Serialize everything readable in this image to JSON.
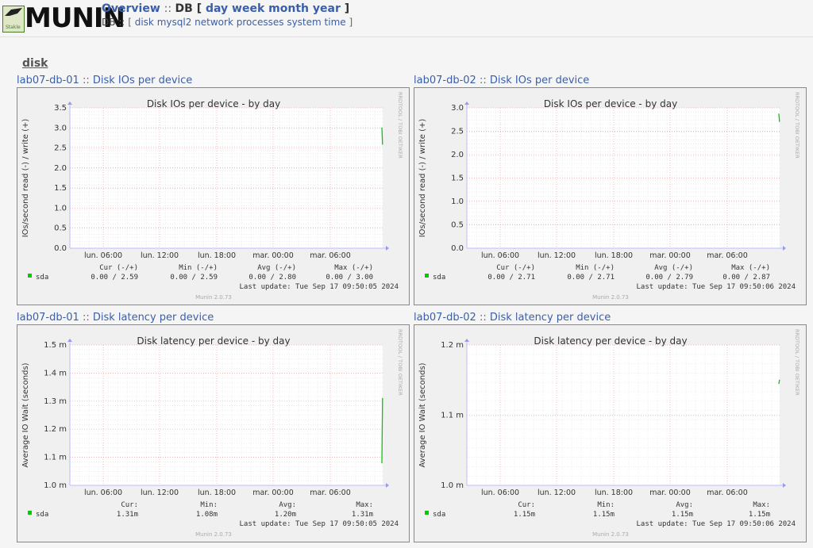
{
  "header": {
    "logo_text": "MUNIN",
    "logo_small": "Stakle",
    "nav_overview": "Overview",
    "nav_group": "DB",
    "periods": [
      "day",
      "week",
      "month",
      "year"
    ],
    "group_label": "DB",
    "categories": [
      "disk",
      "mysql2",
      "network",
      "processes",
      "system",
      "time"
    ]
  },
  "section_title": "disk",
  "graphs": [
    {
      "host": "lab07-db-01",
      "link": "Disk IOs per device",
      "chart_title": "Disk IOs per device - by day",
      "ylabel": "IOs/second read (-) / write (+)",
      "side": "RRDTOOL / TOBI OETIKER",
      "yticks": [
        "3.5",
        "3.0",
        "2.5",
        "2.0",
        "1.5",
        "1.0",
        "0.5",
        "0.0"
      ],
      "xticks": [
        "lun. 06:00",
        "lun. 12:00",
        "lun. 18:00",
        "mar. 00:00",
        "mar. 06:00"
      ],
      "legend_header": [
        "Cur (-/+)",
        "Min (-/+)",
        "Avg (-/+)",
        "Max (-/+)"
      ],
      "series_name": "sda",
      "legend_values": [
        "0.00 /  2.59",
        "0.00 /  2.59",
        "0.00 /  2.80",
        "0.00 /  3.00"
      ],
      "last_update": "Last update: Tue Sep 17 09:50:05 2024",
      "footer": "Munin 2.0.73"
    },
    {
      "host": "lab07-db-02",
      "link": "Disk IOs per device",
      "chart_title": "Disk IOs per device - by day",
      "ylabel": "IOs/second read (-) / write (+)",
      "side": "RRDTOOL / TOBI OETIKER",
      "yticks": [
        "3.0",
        "2.5",
        "2.0",
        "1.5",
        "1.0",
        "0.5",
        "0.0"
      ],
      "xticks": [
        "lun. 06:00",
        "lun. 12:00",
        "lun. 18:00",
        "mar. 00:00",
        "mar. 06:00"
      ],
      "legend_header": [
        "Cur (-/+)",
        "Min (-/+)",
        "Avg (-/+)",
        "Max (-/+)"
      ],
      "series_name": "sda",
      "legend_values": [
        "0.00 /  2.71",
        "0.00 /  2.71",
        "0.00 /  2.79",
        "0.00 /  2.87"
      ],
      "last_update": "Last update: Tue Sep 17 09:50:06 2024",
      "footer": "Munin 2.0.73"
    },
    {
      "host": "lab07-db-01",
      "link": "Disk latency per device",
      "chart_title": "Disk latency per device - by day",
      "ylabel": "Average IO Wait (seconds)",
      "side": "RRDTOOL / TOBI OETIKER",
      "yticks": [
        "1.5 m",
        "1.4 m",
        "1.3 m",
        "1.2 m",
        "1.1 m",
        "1.0 m"
      ],
      "xticks": [
        "lun. 06:00",
        "lun. 12:00",
        "lun. 18:00",
        "mar. 00:00",
        "mar. 06:00"
      ],
      "legend_header": [
        "Cur:",
        "Min:",
        "Avg:",
        "Max:"
      ],
      "series_name": "sda",
      "legend_values": [
        "1.31m",
        "1.08m",
        "1.20m",
        "1.31m"
      ],
      "last_update": "Last update: Tue Sep 17 09:50:05 2024",
      "footer": "Munin 2.0.73"
    },
    {
      "host": "lab07-db-02",
      "link": "Disk latency per device",
      "chart_title": "Disk latency per device - by day",
      "ylabel": "Average IO Wait (seconds)",
      "side": "RRDTOOL / TOBI OETIKER",
      "yticks": [
        "1.2 m",
        "1.1 m",
        "1.0 m"
      ],
      "xticks": [
        "lun. 06:00",
        "lun. 12:00",
        "lun. 18:00",
        "mar. 00:00",
        "mar. 06:00"
      ],
      "legend_header": [
        "Cur:",
        "Min:",
        "Avg:",
        "Max:"
      ],
      "series_name": "sda",
      "legend_values": [
        "1.15m",
        "1.15m",
        "1.15m",
        "1.15m"
      ],
      "last_update": "Last update: Tue Sep 17 09:50:06 2024",
      "footer": "Munin 2.0.73"
    }
  ],
  "colors": {
    "series": "#00cc00",
    "link": "#3a5fa8",
    "grid_major": "#f0a0a0",
    "grid_minor": "#e0e0e0"
  },
  "chart_data": [
    {
      "type": "line",
      "title": "Disk IOs per device - by day",
      "ylabel": "IOs/second read (-) / write (+)",
      "ylim": [
        0,
        3.5
      ],
      "series": [
        {
          "name": "sda",
          "x": [
            "mar. 09:45",
            "mar. 09:50"
          ],
          "values": [
            3.0,
            2.59
          ]
        }
      ]
    },
    {
      "type": "line",
      "title": "Disk IOs per device - by day",
      "ylabel": "IOs/second read (-) / write (+)",
      "ylim": [
        0,
        3.0
      ],
      "series": [
        {
          "name": "sda",
          "x": [
            "mar. 09:45",
            "mar. 09:50"
          ],
          "values": [
            2.87,
            2.71
          ]
        }
      ]
    },
    {
      "type": "line",
      "title": "Disk latency per device - by day",
      "ylabel": "Average IO Wait (seconds)",
      "ylim": [
        1.0,
        1.5
      ],
      "series": [
        {
          "name": "sda",
          "x": [
            "mar. 09:45",
            "mar. 09:50"
          ],
          "values": [
            1.08,
            1.31
          ]
        }
      ]
    },
    {
      "type": "line",
      "title": "Disk latency per device - by day",
      "ylabel": "Average IO Wait (seconds)",
      "ylim": [
        1.0,
        1.2
      ],
      "series": [
        {
          "name": "sda",
          "x": [
            "mar. 09:45",
            "mar. 09:50"
          ],
          "values": [
            1.145,
            1.15
          ]
        }
      ]
    }
  ]
}
